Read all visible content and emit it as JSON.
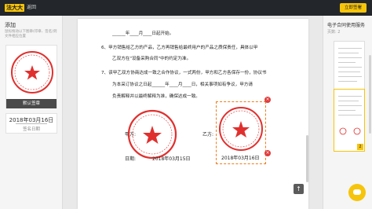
{
  "topbar": {
    "logo": "法大大",
    "back": "返回",
    "confirm": "立即签署"
  },
  "left": {
    "title": "添加",
    "hint": "鼠标拖动以下图章(印章、签名)到文件相应位置",
    "seal_default_label": "默认签章",
    "date_value": "2018年03月16日",
    "date_label": "签名日期",
    "seal_text": "XX有限公司"
  },
  "doc": {
    "lines": [
      "______年____月____日起开始。",
      "6、甲方销售给乙方的产品，乙方再销售给最终用户的产品之质保责任，具体以甲",
      "乙双方在\"设备采购合同\"中的约定为准。",
      "7、该甲乙双方协商达成一致之合作协议，一式两份，甲方和乙方各保存一份，协议书",
      "为本采订协议之日起______年____月____日，相关事项如有争议，甲方请",
      "负责解释并以最终解释为准，确保达成一致。"
    ],
    "party_a_label": "甲方:",
    "party_b_label": "乙方:",
    "party_a_seal_text": "XX有限公司",
    "party_b_seal_text": "XX有限公司",
    "date_prefix": "日期:",
    "party_a_date": "2018年03月15日",
    "party_b_date": "2018年03月16日"
  },
  "right": {
    "title": "电子合同使用服务",
    "pages": "页数: 2",
    "active_page": "2"
  },
  "colors": {
    "accent": "#f6c40a",
    "seal_red": "#e0302e",
    "topbar": "#23272b"
  }
}
